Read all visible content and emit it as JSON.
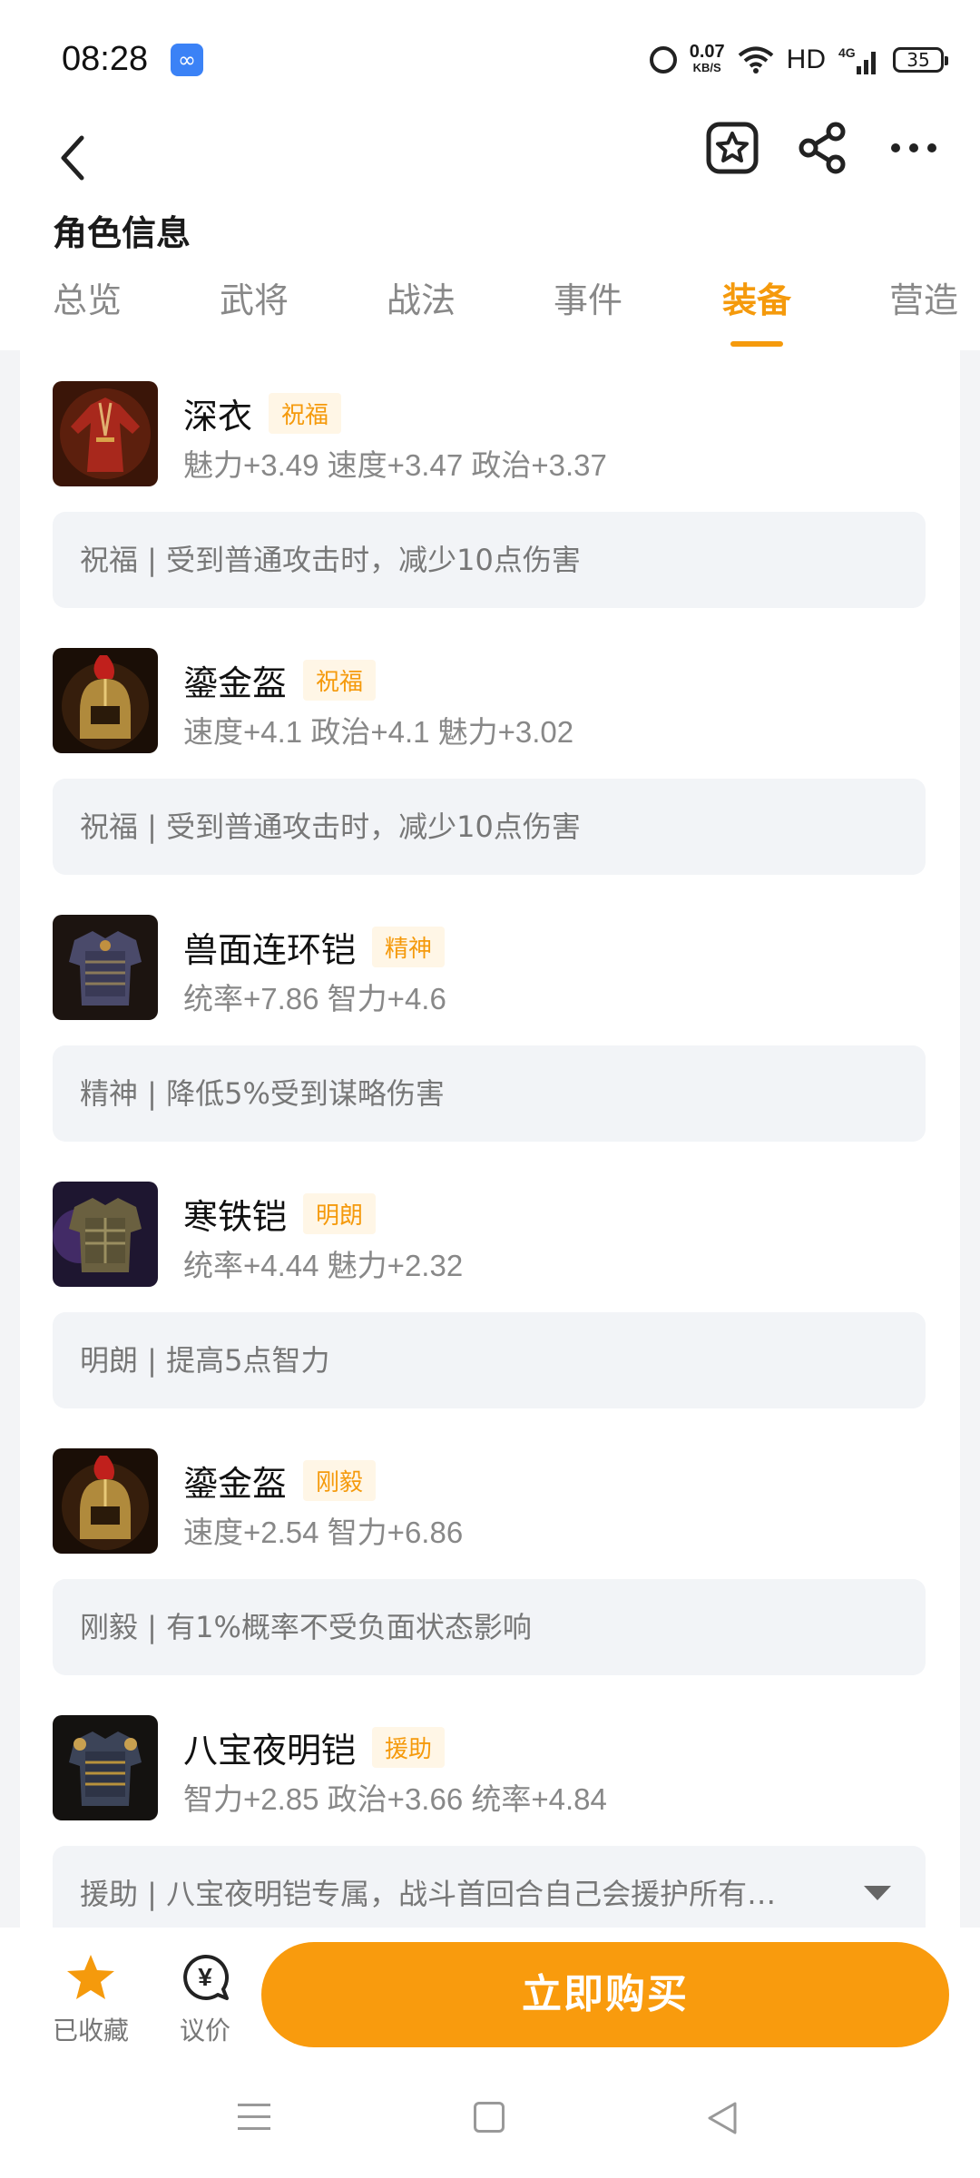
{
  "status_bar": {
    "time": "08:28",
    "app_icon": "∞",
    "net_speed_value": "0.07",
    "net_speed_unit": "KB/S",
    "network_label": "HD",
    "signal_label": "4G",
    "battery": "35"
  },
  "header": {
    "title": "角色信息",
    "icons": [
      "back-icon",
      "favorite-star-icon",
      "share-icon",
      "more-icon"
    ]
  },
  "tabs": [
    {
      "label": "总览",
      "active": false
    },
    {
      "label": "武将",
      "active": false
    },
    {
      "label": "战法",
      "active": false
    },
    {
      "label": "事件",
      "active": false
    },
    {
      "label": "装备",
      "active": true
    },
    {
      "label": "营造",
      "active": false
    }
  ],
  "items": [
    {
      "name": "深衣",
      "tag": "祝福",
      "stats": "魅力+3.49 速度+3.47 政治+3.37",
      "desc": "祝福 | 受到普通攻击时，减少10点伤害"
    },
    {
      "name": "鎏金盔",
      "tag": "祝福",
      "stats": "速度+4.1 政治+4.1 魅力+3.02",
      "desc": "祝福 | 受到普通攻击时，减少10点伤害"
    },
    {
      "name": "兽面连环铠",
      "tag": "精神",
      "stats": "统率+7.86 智力+4.6",
      "desc": "精神 | 降低5%受到谋略伤害"
    },
    {
      "name": "寒铁铠",
      "tag": "明朗",
      "stats": "统率+4.44 魅力+2.32",
      "desc": "明朗 | 提高5点智力"
    },
    {
      "name": "鎏金盔",
      "tag": "刚毅",
      "stats": "速度+2.54 智力+6.86",
      "desc": "刚毅 | 有1%概率不受负面状态影响"
    },
    {
      "name": "八宝夜明铠",
      "tag": "援助",
      "stats": "智力+2.85 政治+3.66 统率+4.84",
      "desc": "援助 | 八宝夜明铠专属，战斗首回合自己会援护所有…"
    }
  ],
  "bottom": {
    "favorite_label": "已收藏",
    "bargain_label": "议价",
    "bargain_symbol": "¥",
    "buy_label": "立即购买"
  },
  "colors": {
    "accent": "#f59a0c",
    "button": "#f99b0d"
  }
}
